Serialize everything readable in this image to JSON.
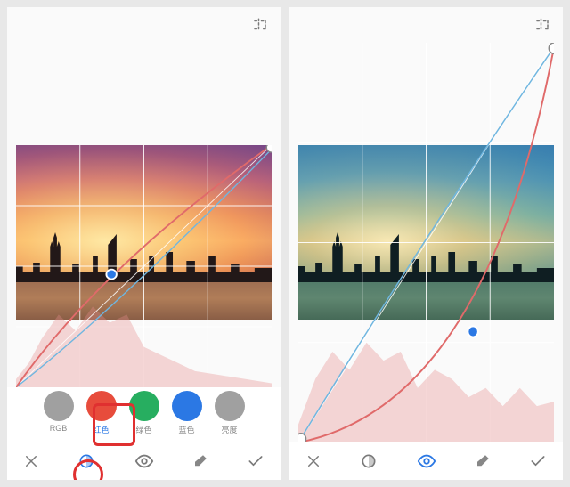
{
  "channels": {
    "rgb": {
      "label": "RGB",
      "color": "#a0a0a0"
    },
    "red": {
      "label": "红色",
      "color": "#e74c3c"
    },
    "green": {
      "label": "绿色",
      "color": "#27ae60"
    },
    "blue": {
      "label": "蓝色",
      "color": "#2b78e4"
    },
    "lum": {
      "label": "亮度",
      "color": "#a0a0a0"
    }
  },
  "left": {
    "active_channel": "red",
    "toolbar_active": "channels"
  },
  "right": {
    "active_channel": "blue",
    "toolbar_active": "visibility"
  },
  "icons": {
    "compare": "compare-icon",
    "close": "close-icon",
    "channels": "channels-icon",
    "visibility": "eye-icon",
    "eraser": "eraser-icon",
    "confirm": "check-icon"
  }
}
